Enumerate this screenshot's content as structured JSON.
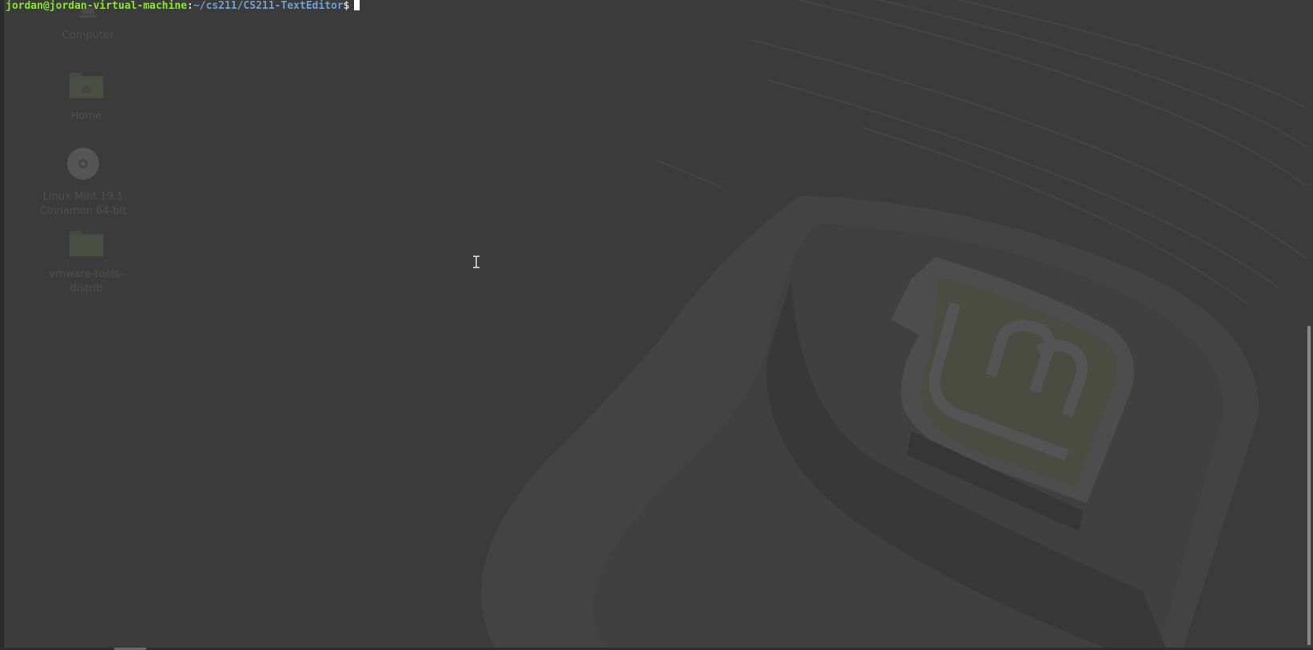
{
  "terminal": {
    "user_host": "jordan@jordan-virtual-machine",
    "separator": ":",
    "path": "~/cs211/CS211-TextEditor",
    "prompt_symbol": "$",
    "colors": {
      "user_host": "#8ae234",
      "path": "#729fcf",
      "text": "#d3d7cf",
      "background": "#3b3b3b"
    }
  },
  "desktop": {
    "icons": [
      {
        "label": "Computer",
        "icon": "computer-icon"
      },
      {
        "label": "Home",
        "icon": "home-folder-icon"
      },
      {
        "label_line1": "Linux Mint 19.1",
        "label_line2": "Cinnamon 64-bit",
        "icon": "disc-icon"
      },
      {
        "label_line1": "vmware-tools-",
        "label_line2": "distrib",
        "icon": "folder-icon"
      }
    ]
  },
  "pointer": {
    "icon": "ibeam-cursor-icon"
  }
}
